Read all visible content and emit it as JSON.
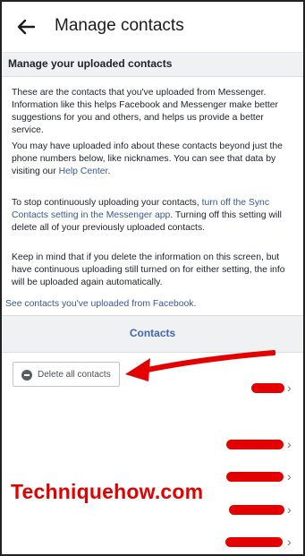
{
  "app_bar": {
    "title": "Manage contacts"
  },
  "section": {
    "header": "Manage your uploaded contacts"
  },
  "paragraphs": {
    "p1": "These are the contacts that you've uploaded from Messenger. Information like this helps Facebook and Messenger make better suggestions for you and others, and helps us provide a better service.",
    "p2_pre": "You may have uploaded info about these contacts beyond just the phone numbers below, like nicknames. You can see that data by visiting our ",
    "p2_link": "Help Center",
    "p2_post": ".",
    "p3_pre": "To stop continuously uploading your contacts, ",
    "p3_link": "turn off the Sync Contacts setting in the Messenger app",
    "p3_post": ". Turning off this setting will delete all of your previously uploaded contacts.",
    "p4": "Keep in mind that if you delete the information on this screen, but have continuous uploading still turned on for either setting, the info will be uploaded again automatically."
  },
  "fb_link": "See contacts you've uploaded from Facebook.",
  "tabs": {
    "contacts": "Contacts"
  },
  "delete_button": {
    "label": "Delete all contacts",
    "icon": "minus-circle-icon"
  },
  "contact_rows": [
    {
      "chevron": "›"
    },
    {
      "chevron": "›"
    },
    {
      "chevron": "›"
    },
    {
      "chevron": "›"
    },
    {
      "chevron": "›"
    }
  ],
  "watermark": "Techniquehow.com",
  "colors": {
    "link": "#385898",
    "tab_accent": "#4267b2",
    "annotation_red": "#e50000"
  }
}
